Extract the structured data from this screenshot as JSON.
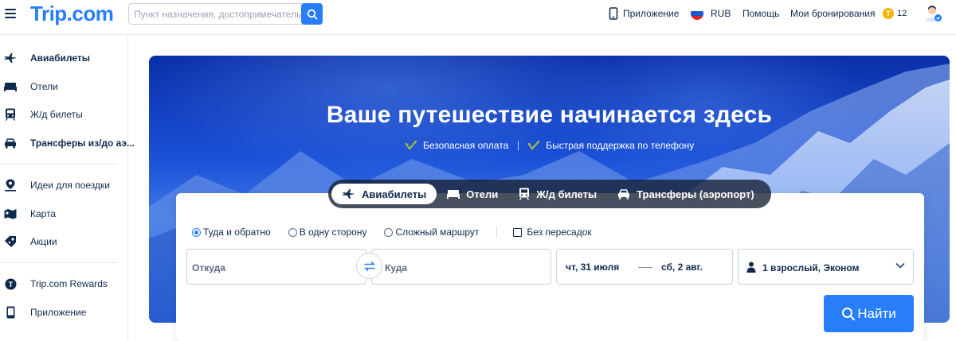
{
  "header": {
    "logo": "Trip.com",
    "search": {
      "placeholder": "Пункт назначения, достопримечательность, отель"
    },
    "app_label": "Приложение",
    "currency": "RUB",
    "help": "Помощь",
    "bookings": "Мои бронирования",
    "coins": "12",
    "icons": [
      "menu-icon",
      "search-icon",
      "phone-icon",
      "russia-flag-icon",
      "trip-coin-icon",
      "user-avatar-icon"
    ]
  },
  "sidebar": {
    "items": [
      {
        "label": "Авиабилеты",
        "icon": "plane-icon"
      },
      {
        "label": "Отели",
        "icon": "bed-icon"
      },
      {
        "label": "Ж/д билеты",
        "icon": "train-icon"
      },
      {
        "label": "Трансферы из/до аэ...",
        "icon": "car-icon"
      },
      {
        "label": "Идеи для поездки",
        "icon": "map-pin-icon"
      },
      {
        "label": "Карта",
        "icon": "map-icon"
      },
      {
        "label": "Акции",
        "icon": "tag-icon"
      },
      {
        "label": "Trip.com Rewards",
        "icon": "rewards-icon"
      },
      {
        "label": "Приложение",
        "icon": "phone-icon"
      }
    ]
  },
  "hero": {
    "title": "Ваше путешествие начинается здесь",
    "badges": [
      "Безопасная оплата",
      "Быстрая поддержка по телефону"
    ]
  },
  "tabs": [
    {
      "label": "Авиабилеты",
      "icon": "plane-icon",
      "active": true
    },
    {
      "label": "Отели",
      "icon": "bed-icon",
      "active": false
    },
    {
      "label": "Ж/д билеты",
      "icon": "train-icon",
      "active": false
    },
    {
      "label": "Трансферы (аэропорт)",
      "icon": "car-icon",
      "active": false
    }
  ],
  "search_form": {
    "trip_types": [
      {
        "label": "Туда и обратно",
        "selected": true
      },
      {
        "label": "В одну сторону",
        "selected": false
      },
      {
        "label": "Сложный маршрут",
        "selected": false
      }
    ],
    "nonstop_label": "Без пересадок",
    "nonstop_checked": false,
    "from_placeholder": "Откуда",
    "to_placeholder": "Куда",
    "depart_date": "чт, 31 июля",
    "return_date": "сб, 2 авг.",
    "passengers": "1 взрослый, Эконом",
    "submit_label": "Найти"
  },
  "colors": {
    "brand": "#287dfa",
    "text": "#0f294d",
    "check_green": "#31c48d",
    "check_gold": "#f7b500"
  }
}
